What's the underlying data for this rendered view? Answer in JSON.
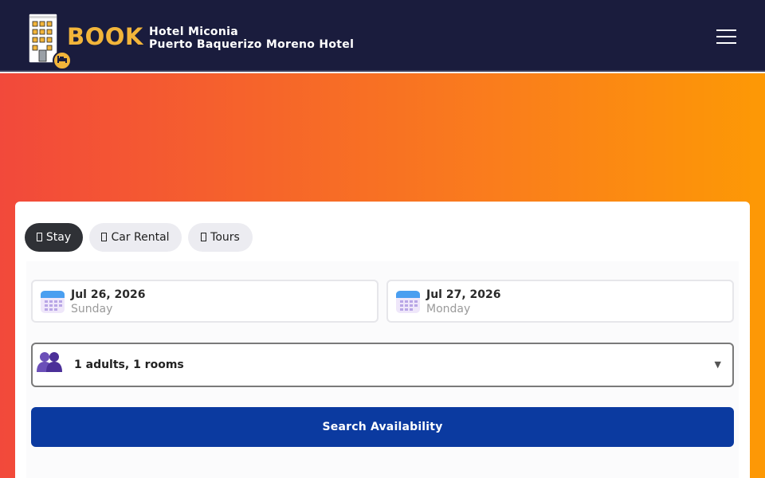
{
  "header": {
    "logo_word": "BOOK",
    "hotel_name": "Hotel Miconia",
    "hotel_subtitle": "Puerto Baquerizo Moreno Hotel",
    "menu_icon": "hamburger-menu-icon"
  },
  "tabs": [
    {
      "label": "Stay",
      "active": true
    },
    {
      "label": "Car Rental",
      "active": false
    },
    {
      "label": "Tours",
      "active": false
    }
  ],
  "checkin": {
    "date": "Jul 26, 2026",
    "weekday": "Sunday",
    "icon": "calendar-icon"
  },
  "checkout": {
    "date": "Jul 27, 2026",
    "weekday": "Monday",
    "icon": "calendar-icon"
  },
  "guests": {
    "value": "1 adults, 1 rooms",
    "icon": "people-icon",
    "caret": "▼"
  },
  "search": {
    "label": "Search Availability"
  },
  "colors": {
    "header_bg": "#1a1c3d",
    "brand_accent": "#f2b53a",
    "button_primary": "#0b3aa0",
    "hero_gradient_start": "#f2493b",
    "hero_gradient_end": "#fd9905"
  }
}
